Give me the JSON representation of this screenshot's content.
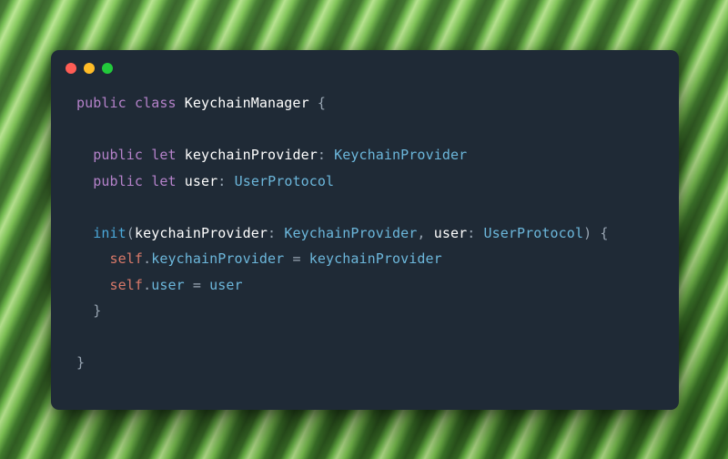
{
  "editor": {
    "traffic_lights": [
      "close",
      "minimize",
      "zoom"
    ],
    "colors": {
      "background": "#1f2a35",
      "keyword": "#b383c7",
      "identifier": "#ffffff",
      "type": "#6fb6d9",
      "function": "#4fa8d8",
      "self": "#d57a6b",
      "punctuation": "#9aa6b2"
    }
  },
  "code": {
    "language": "swift",
    "tokens": {
      "kw_public": "public",
      "kw_class": "class",
      "kw_let": "let",
      "class_name": "KeychainManager",
      "lbrace": "{",
      "rbrace": "}",
      "prop1_name": "keychainProvider",
      "prop1_type": "KeychainProvider",
      "prop2_name": "user",
      "prop2_type": "UserProtocol",
      "fn_init": "init",
      "lparen": "(",
      "rparen": ")",
      "param1_label": "keychainProvider",
      "param1_type": "KeychainProvider",
      "param2_label": "user",
      "param2_type": "UserProtocol",
      "comma": ",",
      "colon": ":",
      "self": "self",
      "dot": ".",
      "assign": "=",
      "body1_lhs": "keychainProvider",
      "body1_rhs": "keychainProvider",
      "body2_lhs": "user",
      "body2_rhs": "user"
    }
  }
}
